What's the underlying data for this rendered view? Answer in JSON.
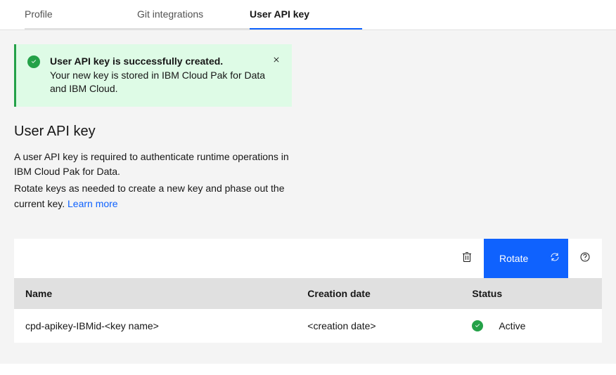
{
  "tabs": {
    "profile": "Profile",
    "git": "Git integrations",
    "apikey": "User API key"
  },
  "notification": {
    "title": "User API key is successfully created.",
    "body": "Your new key is stored in IBM Cloud Pak for Data and IBM Cloud."
  },
  "page": {
    "title": "User API key",
    "desc1": "A user API key is required to authenticate runtime operations in IBM Cloud Pak for Data.",
    "desc2": "Rotate keys as needed to create a new key and phase out the current key. ",
    "learn_more": "Learn more"
  },
  "toolbar": {
    "rotate": "Rotate"
  },
  "table": {
    "headers": {
      "name": "Name",
      "date": "Creation date",
      "status": "Status"
    },
    "row": {
      "name": "cpd-apikey-IBMid-<key name>",
      "date": "<creation date>",
      "status": "Active"
    }
  }
}
